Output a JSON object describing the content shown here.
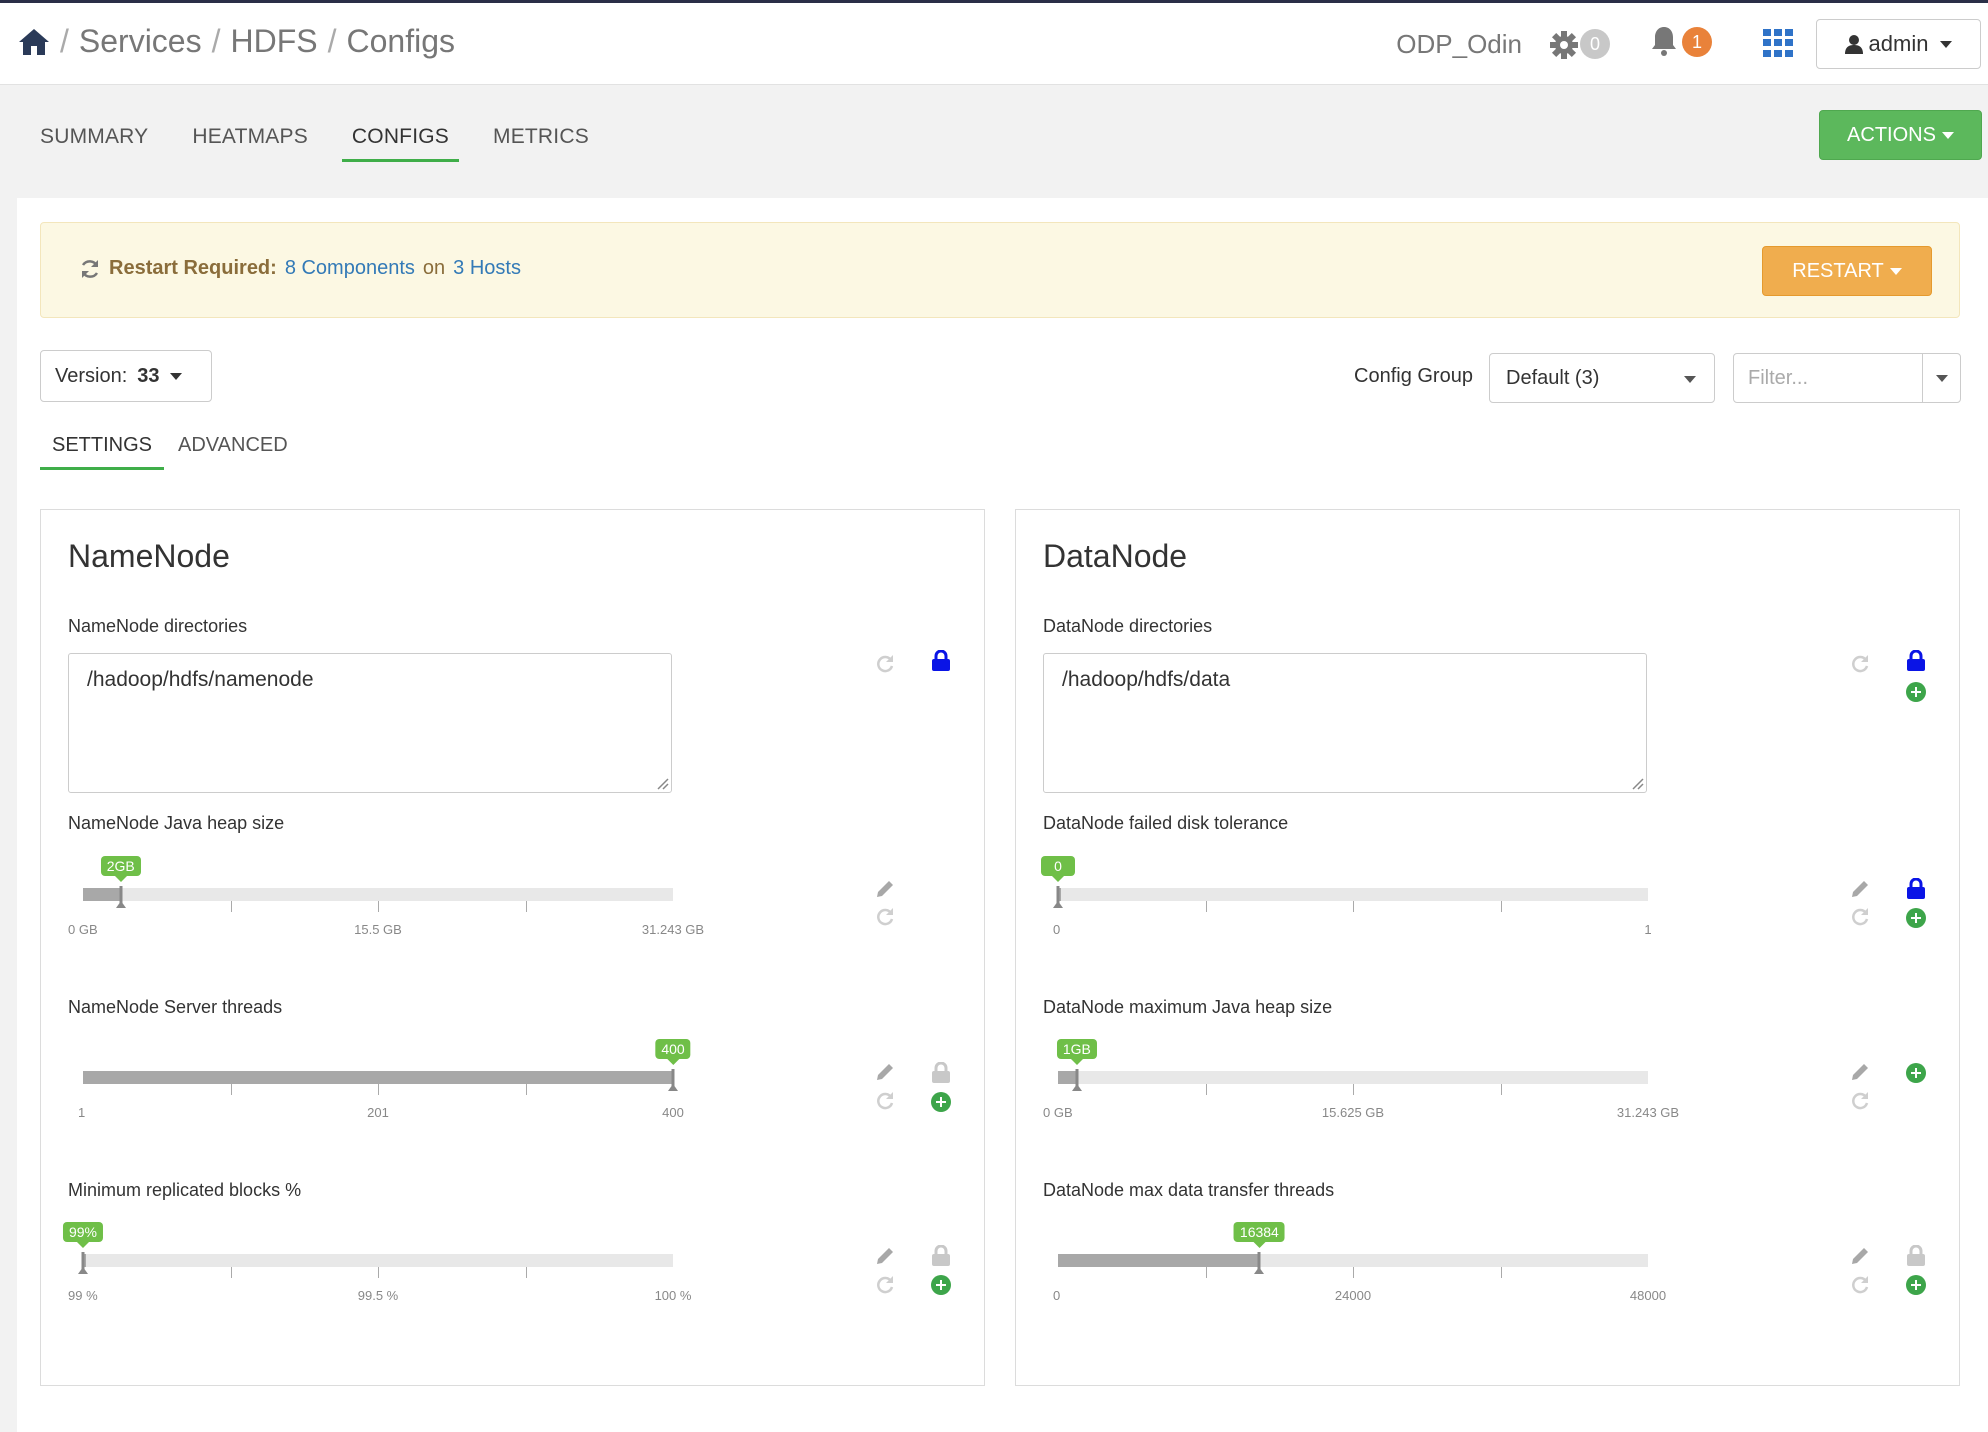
{
  "breadcrumb": {
    "services": "Services",
    "hdfs": "HDFS",
    "configs": "Configs",
    "sep": "/"
  },
  "header": {
    "cluster": "ODP_Odin",
    "ops_count": "0",
    "alerts_count": "1",
    "user": "admin"
  },
  "nav": {
    "tabs": [
      {
        "label": "SUMMARY"
      },
      {
        "label": "HEATMAPS"
      },
      {
        "label": "CONFIGS"
      },
      {
        "label": "METRICS"
      }
    ],
    "actions": "ACTIONS"
  },
  "alert": {
    "title": "Restart Required:",
    "components": "8 Components",
    "on": "on",
    "hosts": "3 Hosts",
    "button": "RESTART"
  },
  "toolbar": {
    "version_label": "Version:",
    "version_value": "33",
    "config_group_label": "Config Group",
    "config_group_value": "Default (3)",
    "filter_placeholder": "Filter..."
  },
  "subtabs": [
    {
      "label": "SETTINGS"
    },
    {
      "label": "ADVANCED"
    }
  ],
  "namenode": {
    "title": "NameNode",
    "dirs_label": "NameNode directories",
    "dirs_value": "/hadoop/hdfs/namenode",
    "heap": {
      "label": "NameNode Java heap size",
      "value_label": "2GB",
      "value": 2,
      "min": 0,
      "max": 31.243,
      "ticks": [
        "0 GB",
        "15.5 GB",
        "31.243 GB"
      ]
    },
    "threads": {
      "label": "NameNode Server threads",
      "value_label": "400",
      "value": 400,
      "min": 1,
      "max": 400,
      "ticks": [
        "1",
        "201",
        "400"
      ]
    },
    "minrep": {
      "label": "Minimum replicated blocks %",
      "value_label": "99%",
      "value": 99,
      "min": 99,
      "max": 100,
      "ticks": [
        "99 %",
        "99.5 %",
        "100 %"
      ]
    }
  },
  "datanode": {
    "title": "DataNode",
    "dirs_label": "DataNode directories",
    "dirs_value": "/hadoop/hdfs/data",
    "tolerance": {
      "label": "DataNode failed disk tolerance",
      "value_label": "0",
      "value": 0,
      "min": 0,
      "max": 1,
      "ticks": [
        "0",
        "1"
      ]
    },
    "heap": {
      "label": "DataNode maximum Java heap size",
      "value_label": "1GB",
      "value": 1,
      "min": 0,
      "max": 31.243,
      "ticks": [
        "0 GB",
        "15.625 GB",
        "31.243 GB"
      ]
    },
    "transfer": {
      "label": "DataNode max data transfer threads",
      "value_label": "16384",
      "value": 16384,
      "min": 0,
      "max": 48000,
      "ticks": [
        "0",
        "24000",
        "48000"
      ]
    }
  },
  "colors": {
    "accent_green": "#3fae49",
    "actions_green": "#5cb85c",
    "restart_orange": "#f0ad4e",
    "lock_blue": "#0a14e6",
    "link_blue": "#337ab7"
  }
}
